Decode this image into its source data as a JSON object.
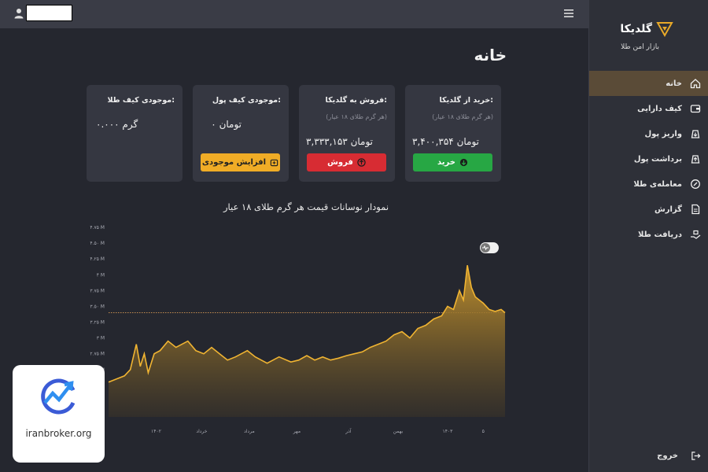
{
  "header": {
    "user_icon": "user-icon",
    "menu_icon": "hamburger-icon"
  },
  "sidebar": {
    "brand_name": "گلدیکا",
    "brand_tagline": "بازار امن طلا",
    "items": [
      {
        "label": "خانه",
        "icon": "home-icon",
        "active": true
      },
      {
        "label": "کیف دارایی",
        "icon": "wallet-icon"
      },
      {
        "label": "واریز پول",
        "icon": "deposit-icon"
      },
      {
        "label": "برداشت پول",
        "icon": "withdraw-icon"
      },
      {
        "label": "معامله‌ی طلا",
        "icon": "trade-icon"
      },
      {
        "label": "گزارش",
        "icon": "report-icon"
      },
      {
        "label": "دریافت طلا",
        "icon": "receive-gold-icon"
      }
    ],
    "logout_label": "خروج"
  },
  "page_title": "خانه",
  "cards": {
    "buy": {
      "title": "خرید از گلدیکا:",
      "subtitle": "(هر گرم طلای ۱۸ عیار)",
      "value": "۳,۴۰۰,۳۵۴ تومان",
      "button": "خرید"
    },
    "sell": {
      "title": "فروش به گلدیکا:",
      "subtitle": "(هر گرم طلای ۱۸ عیار)",
      "value": "۳,۳۳۳,۱۵۳ تومان",
      "button": "فروش"
    },
    "wallet_money": {
      "title": "موجودی کیف پول:",
      "value": "۰ تومان",
      "button": "افزایش موجودی"
    },
    "wallet_gold": {
      "title": "موجودی کیف طلا:",
      "value": "۰.۰۰۰ گرم"
    }
  },
  "colors": {
    "accent": "#f0ac26",
    "buy": "#27a744",
    "sell": "#d72c33",
    "active_nav": "#5a4b37"
  },
  "chart_data": {
    "type": "area",
    "title": "نمودار نوسانات قیمت هر گرم طلای ۱۸ عیار",
    "y_ticks": [
      "۲ M",
      "۲.۲۵ M",
      "۲.۵ M",
      "۲.۷۵ M",
      "۳ M",
      "۳.۲۵ M",
      "۳.۵۰ M",
      "۳.۷۵ M",
      "۴ M",
      "۴.۲۵ M",
      "۴.۵۰ M",
      "۴.۷۵ M"
    ],
    "y_tick_values": [
      2.0,
      2.25,
      2.5,
      2.75,
      3.0,
      3.25,
      3.5,
      3.75,
      4.0,
      4.25,
      4.5,
      4.75
    ],
    "ylim": [
      1.75,
      4.8
    ],
    "x_ticks": [
      {
        "label": "۱۴۰۲",
        "t": 0.12
      },
      {
        "label": "خرداد",
        "t": 0.235
      },
      {
        "label": "مرداد",
        "t": 0.355
      },
      {
        "label": "مهر",
        "t": 0.475
      },
      {
        "label": "آذر",
        "t": 0.605
      },
      {
        "label": "بهمن",
        "t": 0.73
      },
      {
        "label": "۱۴۰۳",
        "t": 0.855
      },
      {
        "label": "۵",
        "t": 0.945
      }
    ],
    "reference_line": 3.4,
    "series": [
      {
        "t": [
          0.0,
          0.02,
          0.04,
          0.055,
          0.07,
          0.08,
          0.09,
          0.1,
          0.115,
          0.13,
          0.15,
          0.17,
          0.2,
          0.22,
          0.24,
          0.26,
          0.28,
          0.3,
          0.32,
          0.35,
          0.37,
          0.4,
          0.43,
          0.46,
          0.48,
          0.5,
          0.52,
          0.54,
          0.56,
          0.58,
          0.6,
          0.62,
          0.64,
          0.66,
          0.68,
          0.7,
          0.72,
          0.74,
          0.76,
          0.78,
          0.8,
          0.82,
          0.84,
          0.855,
          0.87,
          0.885,
          0.895,
          0.905,
          0.915,
          0.925,
          0.935,
          0.945,
          0.96,
          0.975,
          0.99,
          1.0
        ],
        "values": [
          2.3,
          2.35,
          2.4,
          2.5,
          2.9,
          2.55,
          2.75,
          2.45,
          2.75,
          2.8,
          2.95,
          2.85,
          2.95,
          2.8,
          2.75,
          2.85,
          2.75,
          2.65,
          2.7,
          2.8,
          2.7,
          2.6,
          2.7,
          2.62,
          2.65,
          2.72,
          2.65,
          2.7,
          2.65,
          2.68,
          2.72,
          2.75,
          2.78,
          2.85,
          2.9,
          2.95,
          3.05,
          3.1,
          3.0,
          3.15,
          3.2,
          3.3,
          3.35,
          3.5,
          3.45,
          3.75,
          3.6,
          4.15,
          3.8,
          3.65,
          3.6,
          3.55,
          3.45,
          3.42,
          3.45,
          3.4
        ]
      }
    ]
  },
  "watermark": {
    "text": "iranbroker.org"
  }
}
